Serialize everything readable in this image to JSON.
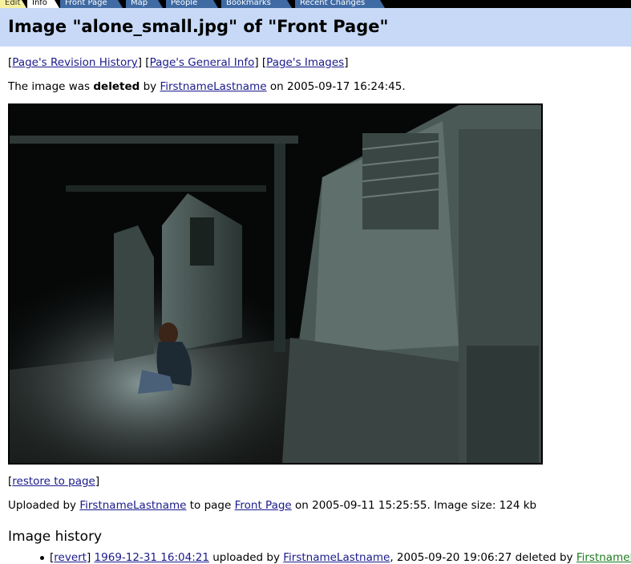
{
  "tabs": {
    "edit": "Edit",
    "info": "Info",
    "front_page": "Front Page",
    "map": "Map",
    "people": "People",
    "bookmarks": "Bookmarks",
    "recent_changes": "Recent Changes"
  },
  "header": {
    "title": "Image \"alone_small.jpg\" of \"Front Page\""
  },
  "nav": {
    "revision_history": "Page's Revision History",
    "general_info": "Page's General Info",
    "images": "Page's Images"
  },
  "deleted": {
    "prefix": "The image was ",
    "status": "deleted",
    "by": " by ",
    "user": "FirstnameLastname",
    "on": " on 2005-09-17 16:24:45."
  },
  "restore": {
    "label": "restore to page"
  },
  "uploaded": {
    "prefix": "Uploaded by ",
    "user": "FirstnameLastname",
    "to_page": " to page ",
    "page": "Front Page",
    "suffix": " on 2005-09-11 15:25:55. Image size: 124 kb"
  },
  "history": {
    "title": "Image history",
    "items": [
      {
        "revert": "revert",
        "date": "1969-12-31 16:04:21",
        "uploaded_by": " uploaded by ",
        "user": "FirstnameLastname",
        "deleted_info": ", 2005-09-20 19:06:27 deleted by ",
        "deleted_user": "FirstnameL"
      }
    ]
  },
  "colors": {
    "header_bg": "#c7d9f7",
    "link": "#1a1a8c",
    "tab_active": "#3f6aa3"
  }
}
